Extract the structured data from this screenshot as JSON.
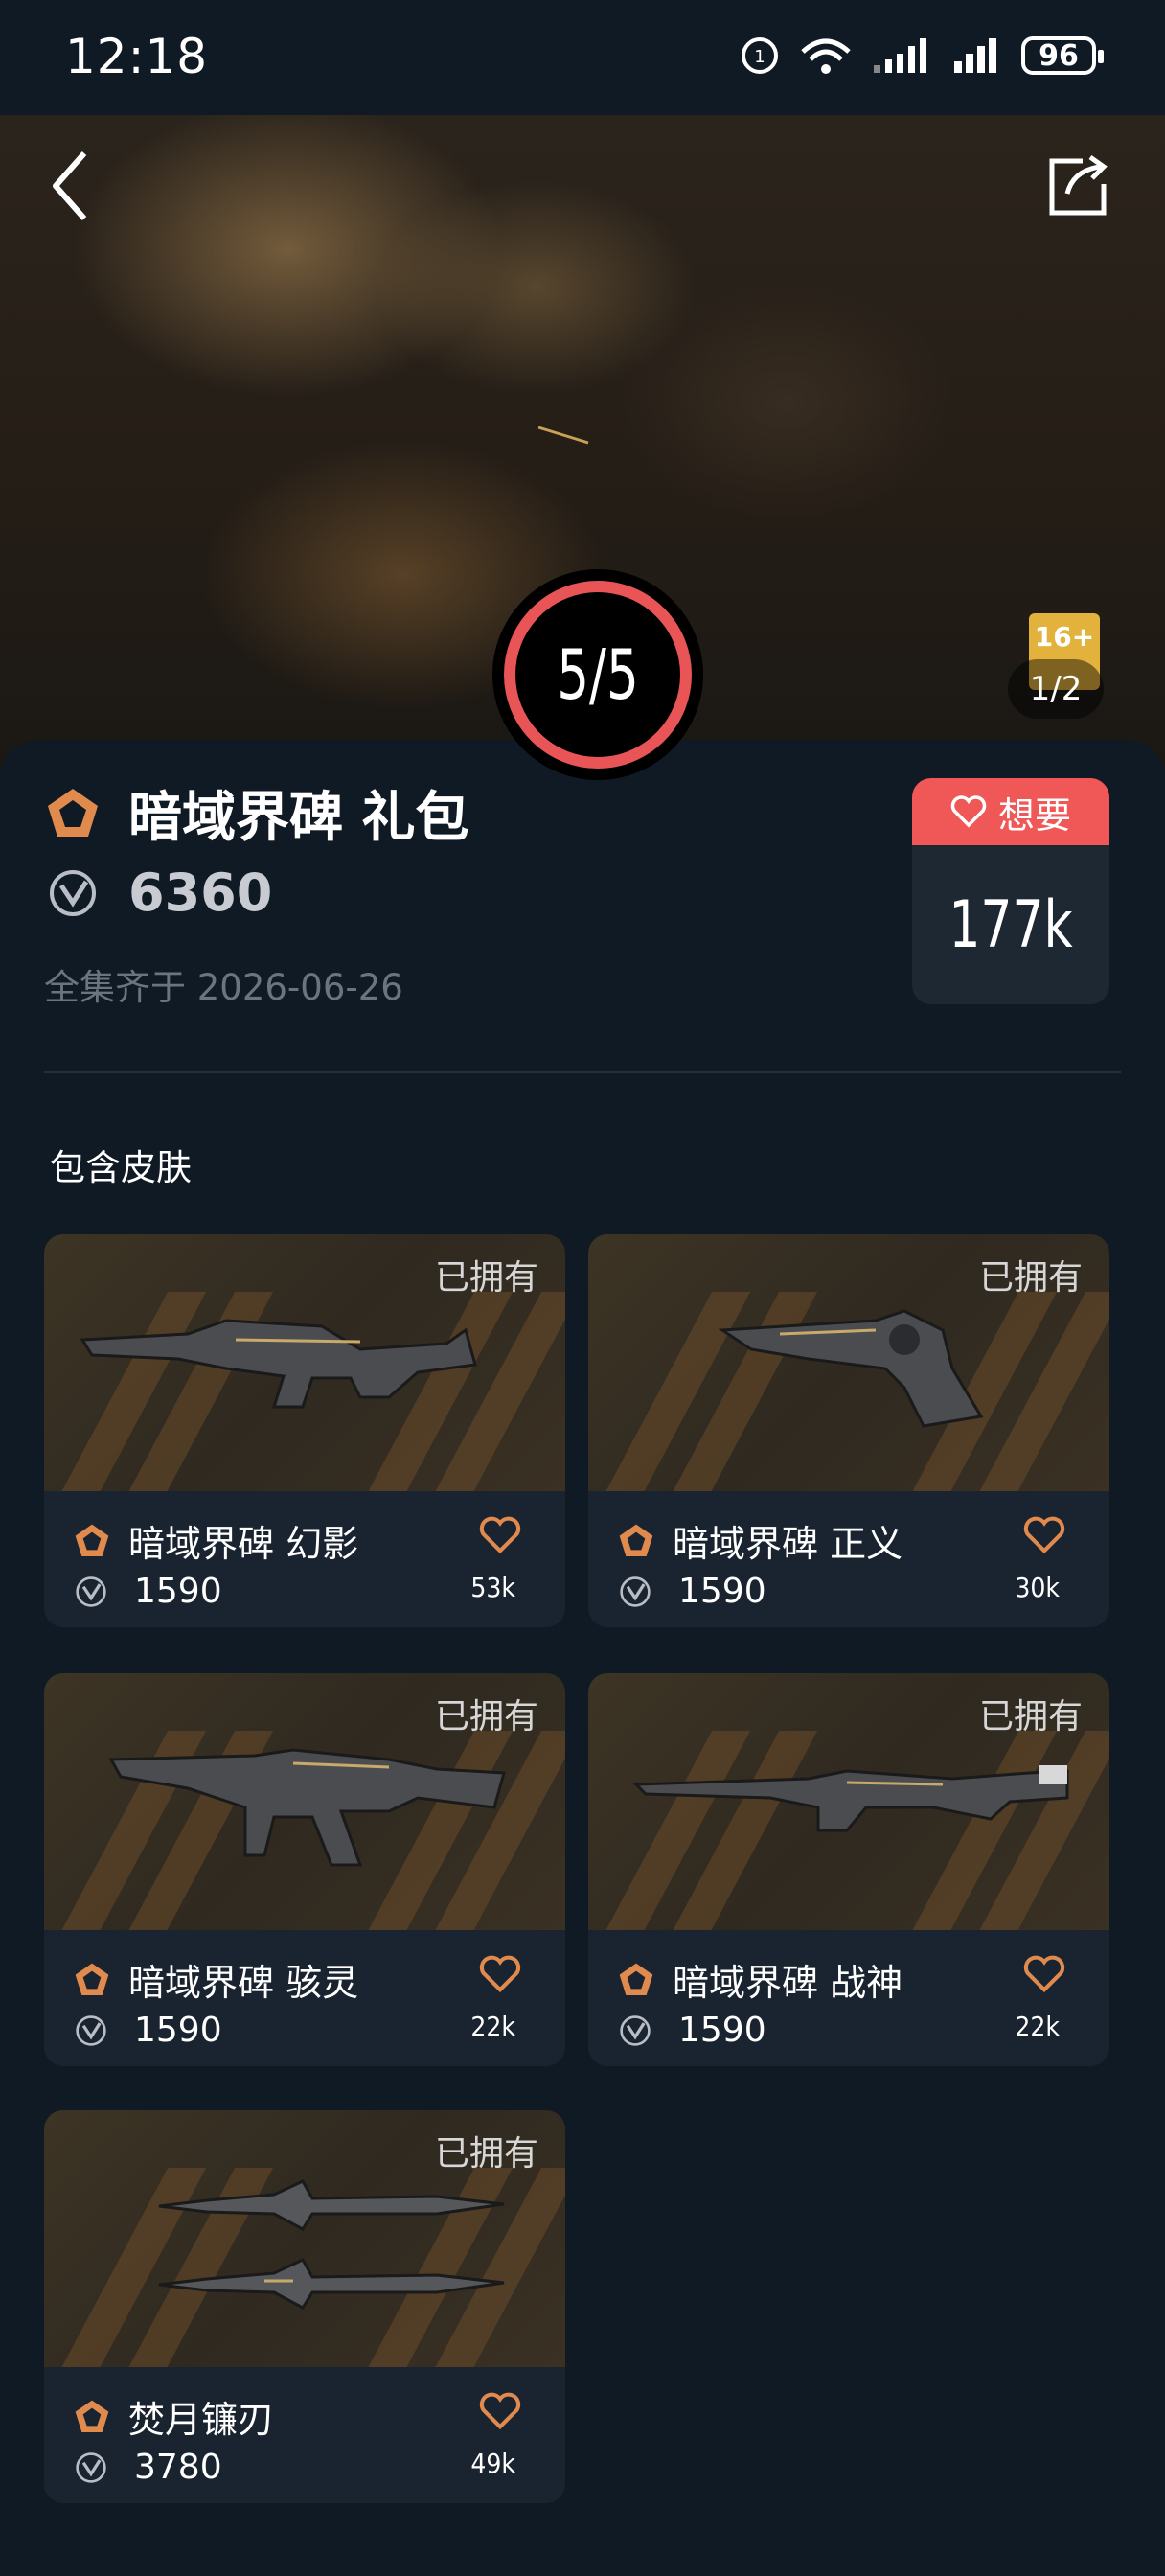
{
  "status_bar": {
    "time": "12:18",
    "battery": "96"
  },
  "hero": {
    "age_rating": "16+",
    "page_indicator": "1/2",
    "progress": "5/5"
  },
  "bundle": {
    "title": "暗域界碑 礼包",
    "price": "6360",
    "collected_text": "全集齐于 2026-06-26",
    "want_label": "想要",
    "want_count": "177k"
  },
  "section_title": "包含皮肤",
  "skins": [
    {
      "name": "暗域界碑 幻影",
      "price": "1590",
      "likes": "53k",
      "owned": "已拥有"
    },
    {
      "name": "暗域界碑 正义",
      "price": "1590",
      "likes": "30k",
      "owned": "已拥有"
    },
    {
      "name": "暗域界碑 骇灵",
      "price": "1590",
      "likes": "22k",
      "owned": "已拥有"
    },
    {
      "name": "暗域界碑 战神",
      "price": "1590",
      "likes": "22k",
      "owned": "已拥有"
    },
    {
      "name": "焚月镰刃",
      "price": "3780",
      "likes": "49k",
      "owned": "已拥有"
    }
  ],
  "colors": {
    "accent": "#f05757",
    "rank": "#e08a4e",
    "background": "#101a24"
  }
}
